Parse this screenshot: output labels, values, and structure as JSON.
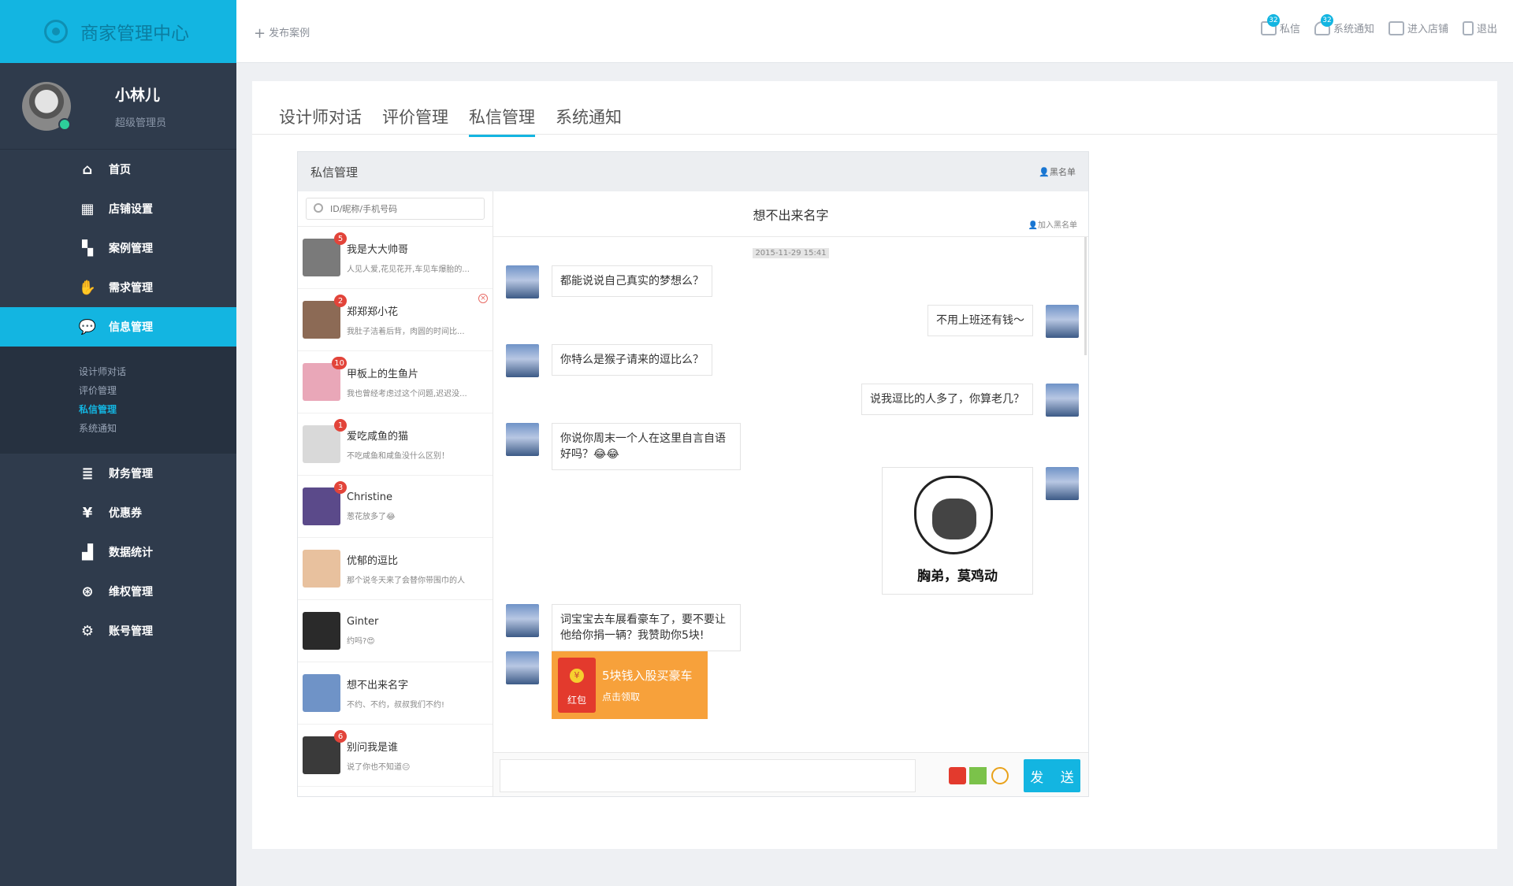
{
  "brand": {
    "title": "商家管理中心"
  },
  "profile": {
    "name": "小林儿",
    "role": "超级管理员"
  },
  "nav": {
    "items": [
      {
        "label": "首页",
        "icon": "home-icon"
      },
      {
        "label": "店铺设置",
        "icon": "shop-icon"
      },
      {
        "label": "案例管理",
        "icon": "grid-icon"
      },
      {
        "label": "需求管理",
        "icon": "hand-icon"
      },
      {
        "label": "信息管理",
        "icon": "chat-icon"
      },
      {
        "label": "财务管理",
        "icon": "coins-icon"
      },
      {
        "label": "优惠券",
        "icon": "coupon-icon"
      },
      {
        "label": "数据统计",
        "icon": "chart-icon"
      },
      {
        "label": "维权管理",
        "icon": "yuan-icon"
      },
      {
        "label": "账号管理",
        "icon": "gear-icon"
      }
    ],
    "sub": [
      "设计师对话",
      "评价管理",
      "私信管理",
      "系统通知"
    ]
  },
  "topbar": {
    "publish": "发布案例",
    "links": [
      {
        "label": "私信",
        "badge": "32"
      },
      {
        "label": "系统通知",
        "badge": "32"
      },
      {
        "label": "进入店铺"
      },
      {
        "label": "退出"
      }
    ]
  },
  "tabs": [
    "设计师对话",
    "评价管理",
    "私信管理",
    "系统通知"
  ],
  "chat": {
    "title": "私信管理",
    "blacklist": "黑名单",
    "search_placeholder": "ID/昵称/手机号码",
    "contacts": [
      {
        "name": "我是大大帅哥",
        "msg": "人见人爱,花见花开,车见车爆胎的...",
        "badge": "5",
        "color": "#7a7a7a"
      },
      {
        "name": "郑郑郑小花",
        "msg": "我肚子洁着后背，肉圆的时间比...",
        "badge": "2",
        "color": "#8c6a55"
      },
      {
        "name": "甲板上的生鱼片",
        "msg": "我也曾经考虑过这个问题,迟迟没...",
        "badge": "10",
        "color": "#e9a7b8"
      },
      {
        "name": "爱吃咸鱼的猫",
        "msg": "不吃咸鱼和咸鱼没什么区别！",
        "badge": "1",
        "color": "#d9d9d9"
      },
      {
        "name": "Christine",
        "msg": "葱花放多了😂",
        "badge": "3",
        "color": "#5b4a8a"
      },
      {
        "name": "优郁的逗比",
        "msg": "那个说冬天来了会替你带围巾的人",
        "badge": "",
        "color": "#e8c19e"
      },
      {
        "name": "Ginter",
        "msg": "约吗?😍",
        "badge": "",
        "color": "#2a2a2a"
      },
      {
        "name": "想不出来名字",
        "msg": "不约、不约，叔叔我们不约!",
        "badge": "",
        "color": "#6f93c7"
      },
      {
        "name": "别问我是谁",
        "msg": "说了你也不知道😐",
        "badge": "6",
        "color": "#3a3a3a"
      }
    ],
    "conversation": {
      "name": "想不出来名字",
      "add_blacklist": "加入黑名单",
      "timestamp": "2015-11-29 15:41",
      "messages": [
        {
          "side": "left",
          "text": "都能说说自己真实的梦想么？"
        },
        {
          "side": "right",
          "text": "不用上班还有钱～"
        },
        {
          "side": "left",
          "text": "你特么是猴子请来的逗比么？"
        },
        {
          "side": "right",
          "text": "说我逗比的人多了，你算老几？"
        },
        {
          "side": "left",
          "text": "你说你周末一个人在这里自言自语好吗？😂😂"
        },
        {
          "side": "right",
          "sticker": "胸弟，莫鸡动"
        },
        {
          "side": "left",
          "text": "词宝宝去车展看豪车了，要不要让他给你捐一辆？我赞助你5块!"
        }
      ],
      "redpacket": {
        "label": "红包",
        "title": "5块钱入股买豪车",
        "sub": "点击领取"
      }
    },
    "send": "发 送"
  },
  "colors": {
    "accent": "#13b5e1",
    "sidebar": "#2f3b4c",
    "badge": "#e2443a",
    "redpacket": "#f7a13b"
  }
}
